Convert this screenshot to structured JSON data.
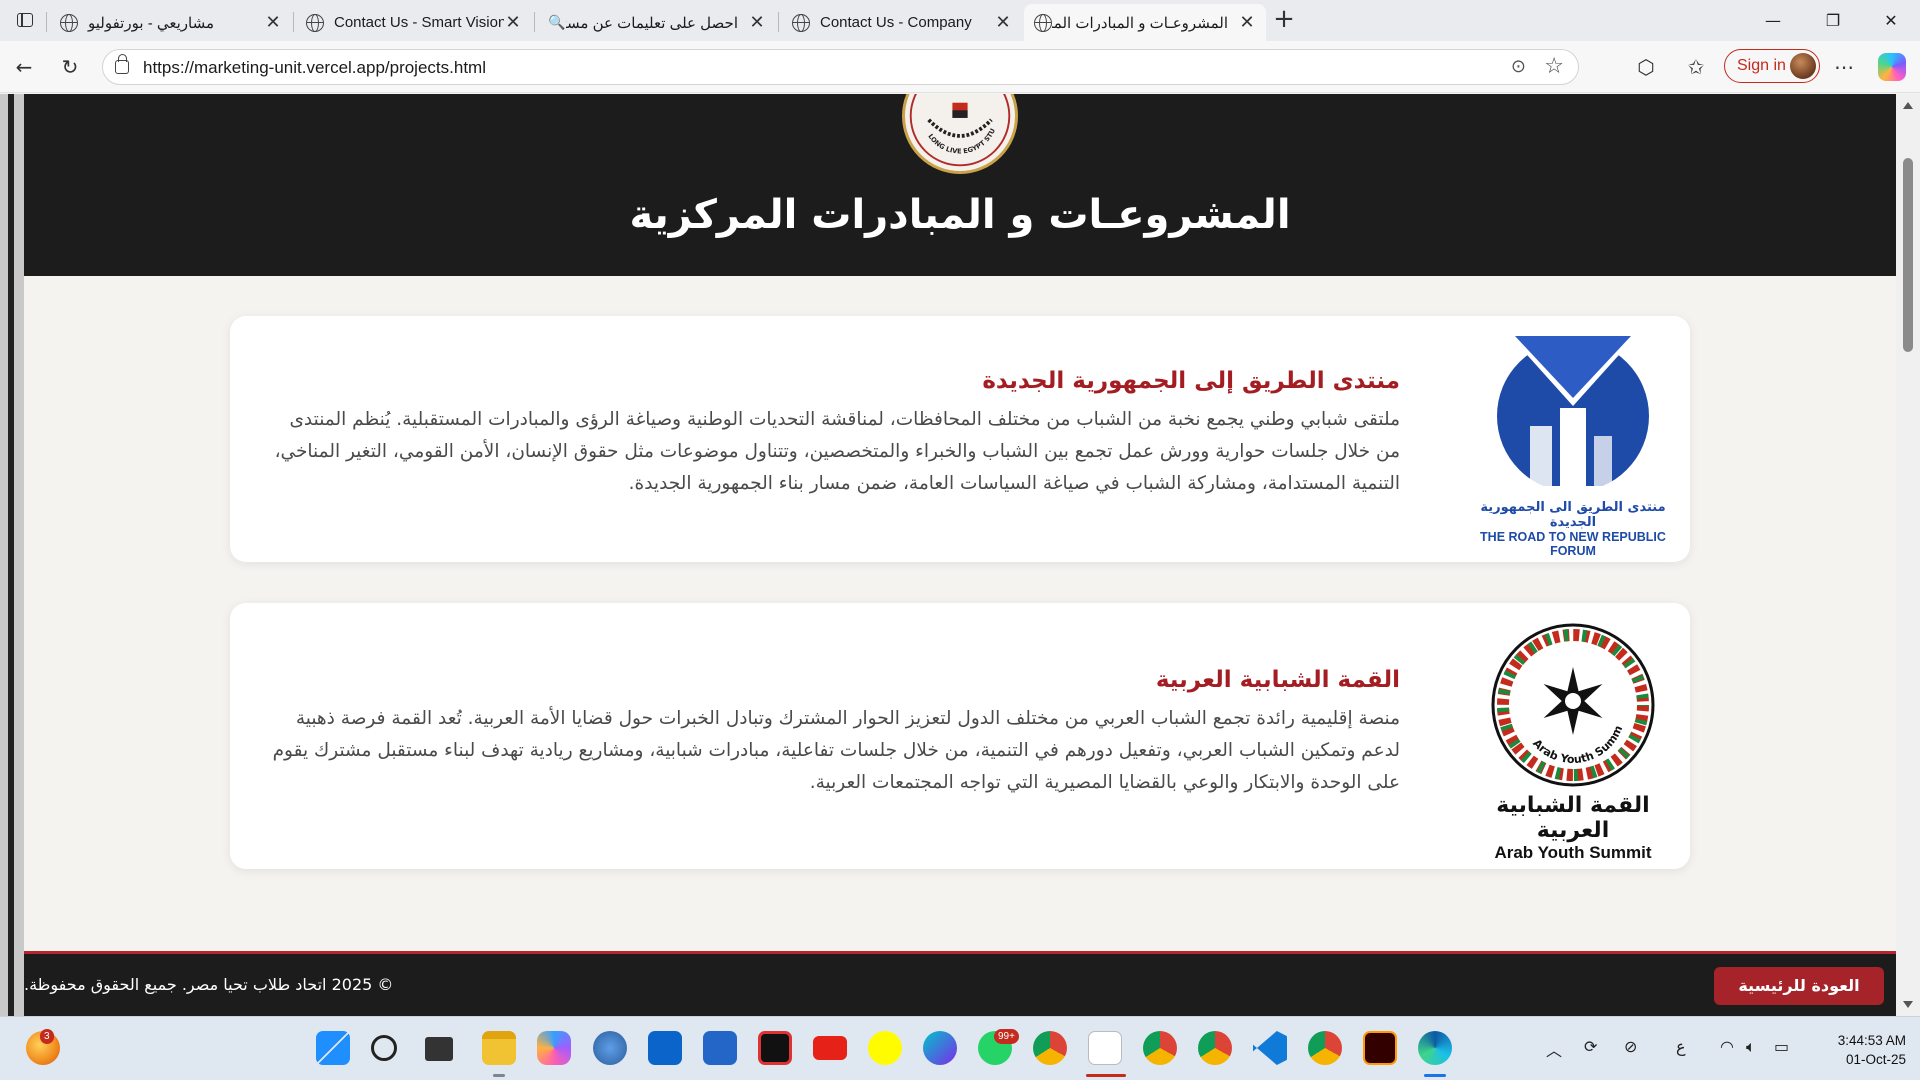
{
  "browser": {
    "tabs": [
      {
        "title": "مشاريعي - بورتفوليو",
        "active": false
      },
      {
        "title": "Contact Us - Smart Vision",
        "active": false
      },
      {
        "title": "احصل على تعليمات عن مستكشف الملفات في",
        "active": false
      },
      {
        "title": "Contact Us - Company",
        "active": false
      },
      {
        "title": "المشروعـات و المبادرات المركزية",
        "active": true
      }
    ],
    "url": "https://marketing-unit.vercel.app/projects.html",
    "sign_in_label": "Sign in"
  },
  "page": {
    "hero_title": "المشروعـات و المبادرات المركزية",
    "hero_logo_text": "LONG LIVE EGYPT STUDENTS UNION",
    "projects": [
      {
        "title": "منتدى الطريق إلى الجمهورية الجديدة",
        "description": "ملتقى شبابي وطني يجمع نخبة من الشباب من مختلف المحافظات، لمناقشة التحديات الوطنية وصياغة الرؤى والمبادرات المستقبلية. يُنظم المنتدى من خلال جلسات حوارية وورش عمل تجمع بين الشباب والخبراء والمتخصصين، وتتناول موضوعات مثل حقوق الإنسان، الأمن القومي، التغير المناخي، التنمية المستدامة، ومشاركة الشباب في صياغة السياسات العامة، ضمن مسار بناء الجمهورية الجديدة.",
        "logo_caption_ar": "منتدى الطريق الى الجمهورية الجديدة",
        "logo_caption_en": "THE ROAD TO NEW REPUBLIC FORUM"
      },
      {
        "title": "القمة الشبابية العربية",
        "description": "منصة إقليمية رائدة تجمع الشباب العربي من مختلف الدول لتعزيز الحوار المشترك وتبادل الخبرات حول قضايا الأمة العربية. تُعد القمة فرصة ذهبية لدعم وتمكين الشباب العربي، وتفعيل دورهم في التنمية، من خلال جلسات تفاعلية، مبادرات شبابية، ومشاريع ريادية تهدف لبناء مستقبل مشترك يقوم على الوحدة والابتكار والوعي بالقضايا المصيرية التي تواجه المجتمعات العربية.",
        "logo_ring_text": "Arab Youth Summit",
        "logo_caption_ar": "القمة الشبابية العربية",
        "logo_caption_en": "Arab Youth Summit"
      }
    ],
    "footer": {
      "copyright": "© 2025 اتحاد طلاب تحيا مصر. جميع الحقوق محفوظة.",
      "home_button": "العودة للرئيسية"
    }
  },
  "taskbar": {
    "notification_badge": "3",
    "whatsapp_badge": "99+",
    "time": "3:44:53 AM",
    "date": "01-Oct-25",
    "language": "ع"
  },
  "colors": {
    "accent_red": "#a31d22",
    "hero_bg": "#1c1c1c",
    "page_bg": "#f5f3ef",
    "logo_blue": "#1e4aa8"
  }
}
